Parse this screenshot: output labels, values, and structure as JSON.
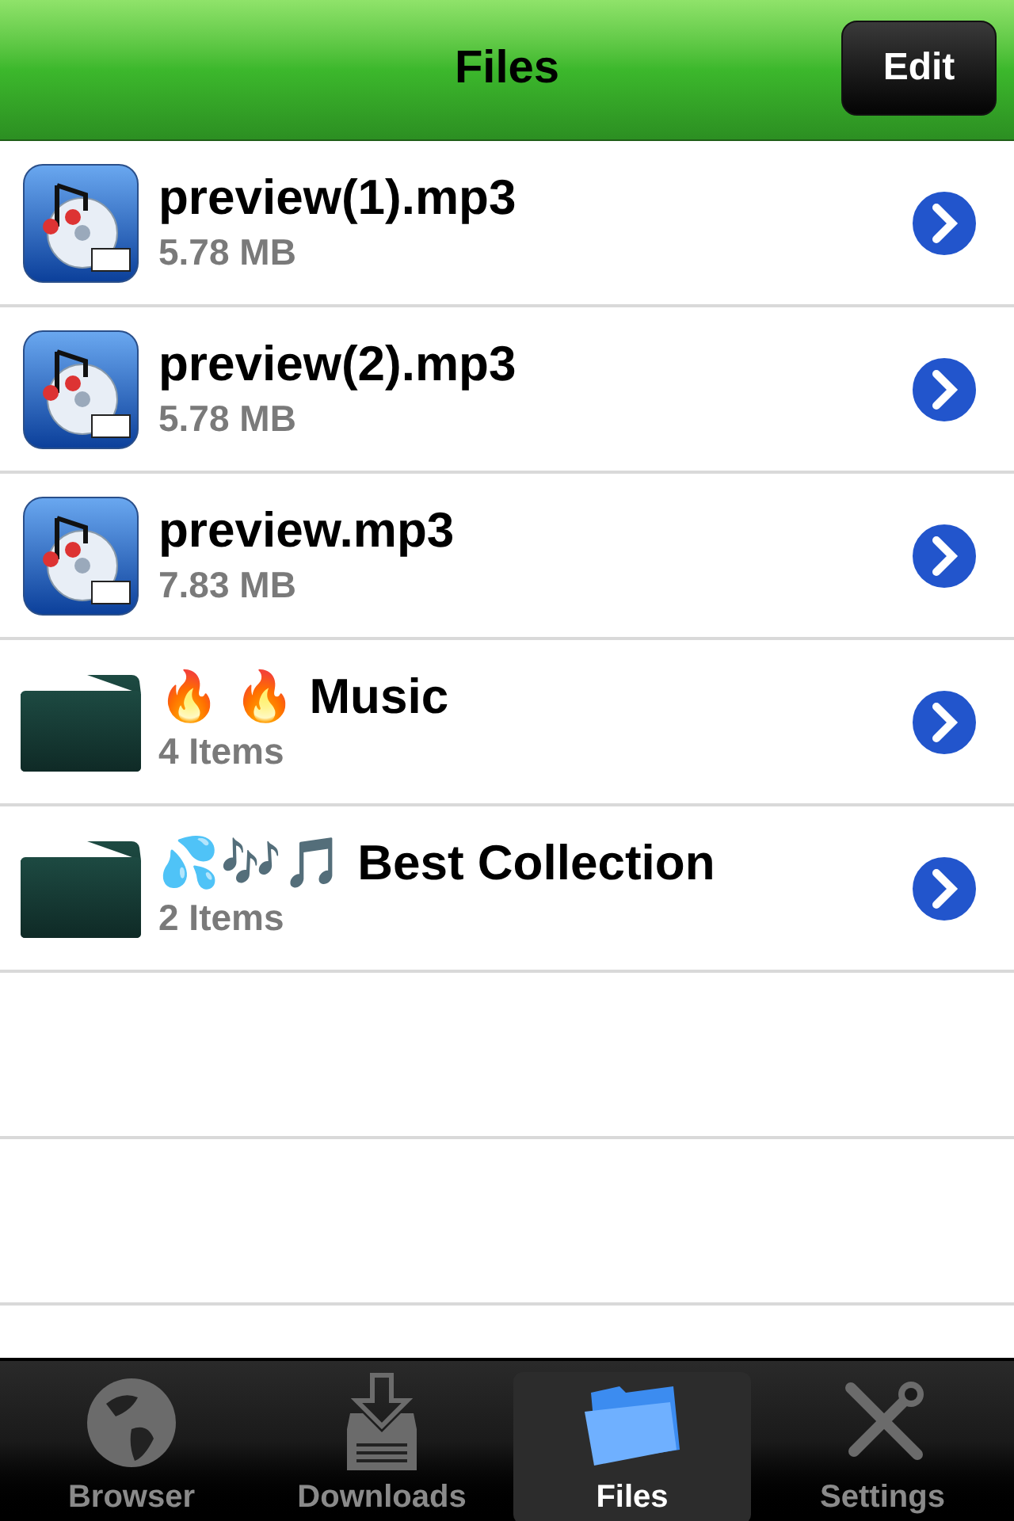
{
  "nav_bar": {
    "title": "Files",
    "edit_button": "Edit"
  },
  "items": [
    {
      "kind": "file",
      "name": "preview(1).mp3",
      "detail": "5.78 MB"
    },
    {
      "kind": "file",
      "name": "preview(2).mp3",
      "detail": "5.78 MB"
    },
    {
      "kind": "file",
      "name": "preview.mp3",
      "detail": "7.83 MB"
    },
    {
      "kind": "folder",
      "name": "🔥 🔥 Music",
      "detail": "4 Items"
    },
    {
      "kind": "folder",
      "name": "💦🎶🎵 Best Collection",
      "detail": "2 Items"
    }
  ],
  "tabs": [
    {
      "kind": "browser",
      "label": "Browser",
      "selected": false
    },
    {
      "kind": "downloads",
      "label": "Downloads",
      "selected": false
    },
    {
      "kind": "files",
      "label": "Files",
      "selected": true
    },
    {
      "kind": "settings",
      "label": "Settings",
      "selected": false
    }
  ]
}
